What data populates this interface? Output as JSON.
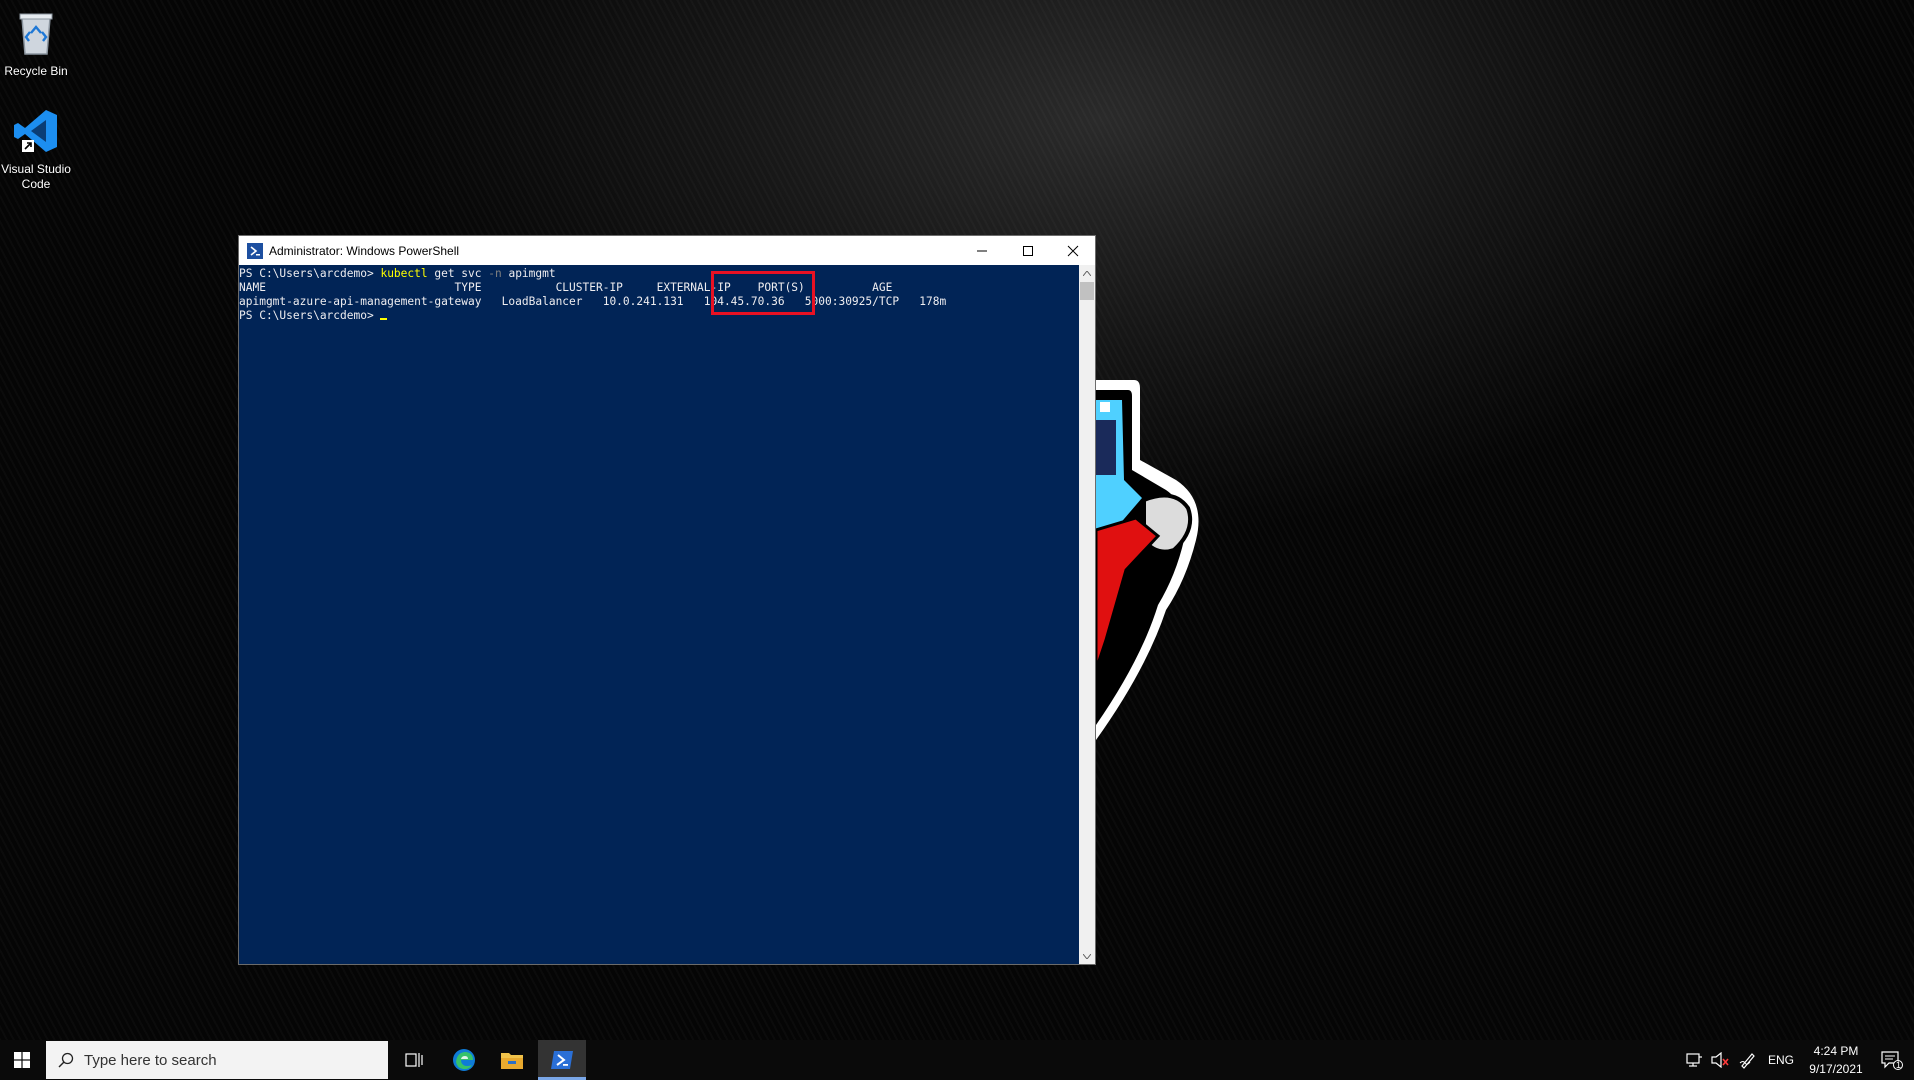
{
  "desktop": {
    "icons": [
      {
        "label": "Recycle Bin"
      },
      {
        "label": "Visual Studio Code"
      }
    ]
  },
  "window": {
    "title": "Administrator: Windows PowerShell",
    "console": {
      "prompt": "PS C:\\Users\\arcdemo> ",
      "command": "kubectl",
      "args1": " get svc ",
      "flag": "-n",
      "args2": " apimgmt",
      "header_row": "NAME                            TYPE           CLUSTER-IP     EXTERNAL-IP    PORT(S)          AGE",
      "data_row": "apimgmt-azure-api-management-gateway   LoadBalancer   10.0.241.131   104.45.70.36   5000:30925/TCP   178m",
      "highlighted_value": "104.45.70.36"
    }
  },
  "taskbar": {
    "search_placeholder": "Type here to search",
    "language": "ENG",
    "time": "4:24 PM",
    "date": "9/17/2021",
    "notification_count": "1"
  },
  "colors": {
    "console_bg": "#012456",
    "console_fg": "#eeedf0",
    "command_color": "#ffff00",
    "highlight_border": "#e81123"
  }
}
